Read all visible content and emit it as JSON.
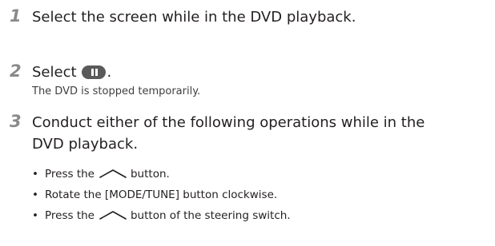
{
  "steps": [
    {
      "number": "1",
      "title": "Select the screen while in the DVD playback."
    },
    {
      "number": "2",
      "title": "Select",
      "title_end": ".",
      "note": "The DVD is stopped temporarily."
    },
    {
      "number": "3",
      "title_line1": "Conduct either of the following operations while in the",
      "title_line2": "DVD playback."
    }
  ],
  "bullets": [
    {
      "before": "Press the",
      "after": "button."
    },
    {
      "text": "Rotate the [MODE/TUNE] button clockwise."
    },
    {
      "before": "Press the",
      "after": "button of the steering switch."
    }
  ],
  "icons": {
    "pause": "pause-button-icon",
    "up": "up-chevron-icon"
  },
  "colors": {
    "step_number": "#8a8a8a",
    "text": "#231f20",
    "icon": "#5a5a5a"
  }
}
